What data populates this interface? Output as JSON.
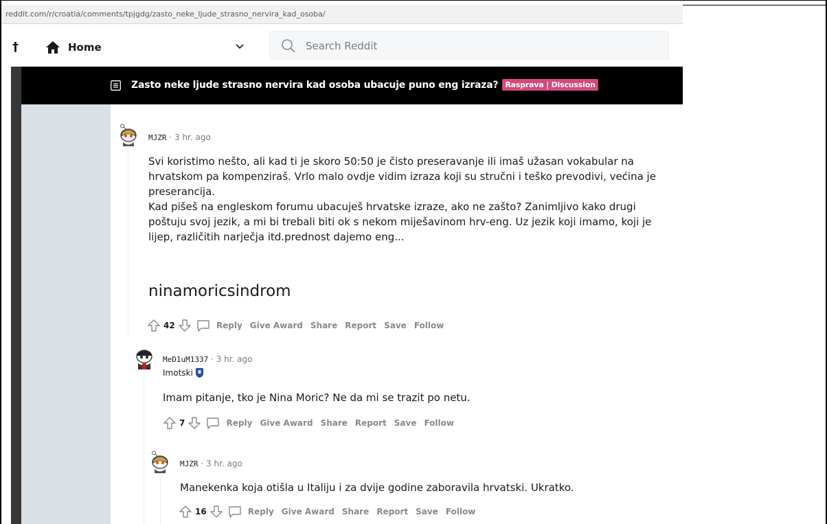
{
  "browser": {
    "url": "reddit.com/r/croatia/comments/tpjgdg/zasto_neke_ljude_strasno_nervira_kad_osoba/"
  },
  "header": {
    "left_glyph": "†",
    "home_label": "Home",
    "search_placeholder": "Search Reddit"
  },
  "post": {
    "title": "Zasto neke ljude strasno nervira kad osoba ubacuje puno eng izraza?",
    "flair": "Rasprava | Discussion",
    "flair_color": "#d44a7c"
  },
  "actions": {
    "reply": "Reply",
    "give_award": "Give Award",
    "share": "Share",
    "report": "Report",
    "save": "Save",
    "follow": "Follow"
  },
  "comments": [
    {
      "username": "MJZR",
      "time": "· 3 hr. ago",
      "paragraphs": [
        "Svi koristimo nešto, ali kad ti je skoro 50:50 je čisto preseravanje ili imaš užasan vokabular na hrvatskom pa kompenziraš. Vrlo malo ovdje vidim izraza koji su stručni i teško prevodivi, većina je preserancija.",
        "Kad pišeš na engleskom forumu ubacuješ hrvatske izraze, ako ne zašto? Zanimljivo kako drugi poštuju svoj jezik, a mi bi trebali biti ok s nekom miješavinom hrv-eng. Uz jezik koji imamo, koji je lijep, različitih narječja itd.prednost dajemo eng..."
      ],
      "large_line": "ninamoricsindrom",
      "score": "42"
    },
    {
      "username": "MeD1uM1337",
      "time": "· 3 hr. ago",
      "user_flair": "Imotski",
      "text": "Imam pitanje, tko je Nina Moric? Ne da mi se trazit po netu.",
      "score": "7"
    },
    {
      "username": "MJZR",
      "time": "· 3 hr. ago",
      "text": "Manekenka koja otišla u Italiju i za dvije godine zaboravila hrvatski. Ukratko.",
      "score": "16"
    }
  ]
}
